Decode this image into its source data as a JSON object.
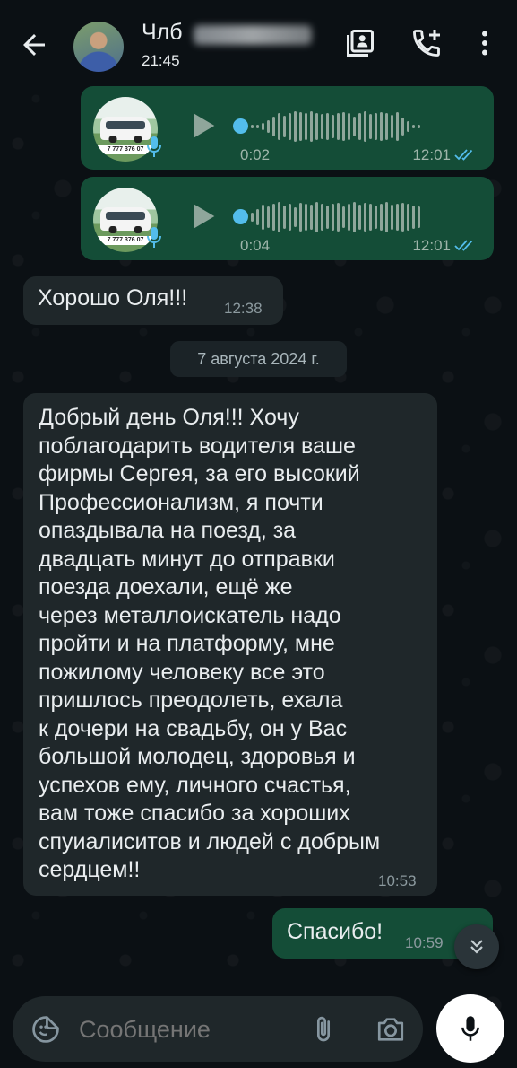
{
  "header": {
    "contact_name": "Члб",
    "last_seen": "21:45"
  },
  "messages": {
    "voice1": {
      "duration": "0:02",
      "time": "12:01",
      "thumb_text": "7 777 376 07"
    },
    "voice2": {
      "duration": "0:04",
      "time": "12:01",
      "thumb_text": "7 777 376 07"
    },
    "msg1": {
      "text": "Хорошо Оля!!!",
      "time": "12:38"
    },
    "date_separator": "7 августа 2024 г.",
    "msg2": {
      "lines": [
        "Добрый день Оля!!! Хочу",
        "поблагодарить водителя ваше",
        "фирмы Сергея, за его высокий",
        "Профессионализм, я почти",
        "опаздывала на поезд, за",
        "двадцать минут до отправки",
        "поезда доехали, ещё же",
        "через металлоискатель надо",
        "пройти и на платформу, мне",
        "пожилому человеку все это",
        "пришлось преодолеть, ехала",
        "к дочери на свадьбу, он у Вас",
        "большой молодец, здоровья и",
        "успехов ему, личного счастья,",
        "вам тоже спасибо за хороших",
        "спуиалиситов и людей с добрым",
        "сердцем!!"
      ],
      "time": "10:53"
    },
    "msg3": {
      "text": "Спасибо!",
      "time": "10:59"
    }
  },
  "input": {
    "placeholder": "Сообщение"
  },
  "colors": {
    "background": "#0b1014",
    "outgoing_bubble": "#144d37",
    "incoming_bubble": "#1f272a",
    "read_ticks": "#53bdeb"
  }
}
